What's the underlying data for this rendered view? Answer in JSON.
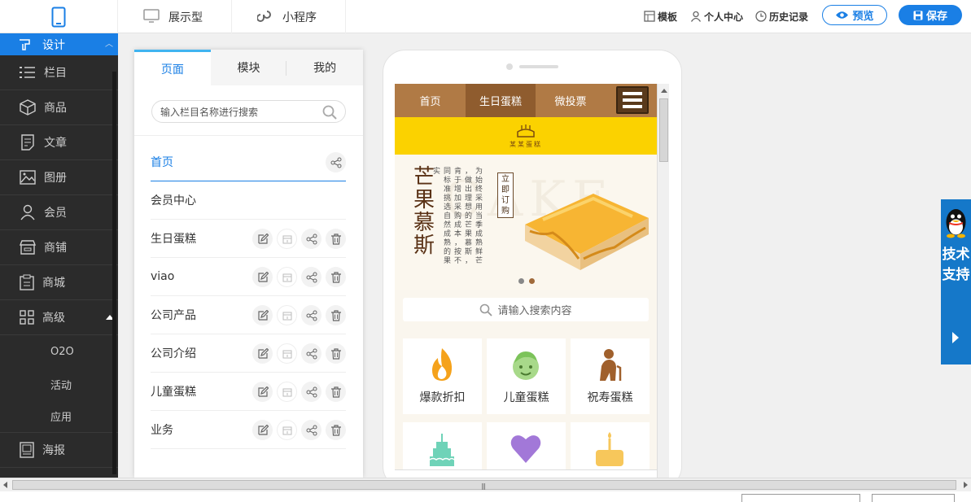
{
  "topbar": {
    "tabs": [
      {
        "label": "展示型",
        "icon": "monitor-icon"
      },
      {
        "label": "小程序",
        "icon": "mini-program-icon"
      }
    ],
    "tools": [
      {
        "label": "模板",
        "icon": "template-icon"
      },
      {
        "label": "个人中心",
        "icon": "user-icon"
      },
      {
        "label": "历史记录",
        "icon": "clock-icon"
      }
    ],
    "preview_label": "预览",
    "save_label": "保存"
  },
  "sidebar": {
    "active": "设计",
    "items": [
      {
        "label": "栏目",
        "icon": "list-icon"
      },
      {
        "label": "商品",
        "icon": "box-icon"
      },
      {
        "label": "文章",
        "icon": "document-icon"
      },
      {
        "label": "图册",
        "icon": "image-icon"
      },
      {
        "label": "会员",
        "icon": "person-icon"
      },
      {
        "label": "商铺",
        "icon": "store-icon"
      },
      {
        "label": "商城",
        "icon": "clipboard-icon"
      },
      {
        "label": "高级",
        "icon": "grid-icon"
      }
    ],
    "subitems": [
      "O2O",
      "活动",
      "应用"
    ],
    "last": {
      "label": "海报",
      "icon": "poster-icon"
    }
  },
  "panel": {
    "tabs": [
      "页面",
      "模块",
      "我的"
    ],
    "search_placeholder": "输入栏目名称进行搜索",
    "pages": [
      "首页",
      "会员中心",
      "生日蛋糕",
      "viao",
      "公司产品",
      "公司介绍",
      "儿童蛋糕",
      "业务"
    ]
  },
  "mobile": {
    "nav": [
      "首页",
      "生日蛋糕",
      "微投票"
    ],
    "brand": "某某蛋糕",
    "banner": {
      "title": "芒果慕斯",
      "desc": "为始终采用当季成熟鲜芒，做出理想的芒果慕斯，肯于增加采购成本，按不同标准挑选自然成熟的果实",
      "order": "立即订购",
      "ghost": "CAKE"
    },
    "search_placeholder": "请输入搜索内容",
    "categories": [
      {
        "label": "爆款折扣",
        "icon": "flame-icon"
      },
      {
        "label": "儿童蛋糕",
        "icon": "child-face-icon"
      },
      {
        "label": "祝寿蛋糕",
        "icon": "elder-icon"
      },
      {
        "label": "",
        "icon": "cake-icon"
      },
      {
        "label": "",
        "icon": "heart-icon"
      },
      {
        "label": "",
        "icon": "birthday-cake-icon"
      }
    ]
  },
  "support": {
    "label": "技术支持"
  },
  "colors": {
    "accent": "#1a7fe5",
    "sidebar": "#2b2b2b",
    "brown": "#b07a45",
    "yellow": "#fbd200"
  }
}
